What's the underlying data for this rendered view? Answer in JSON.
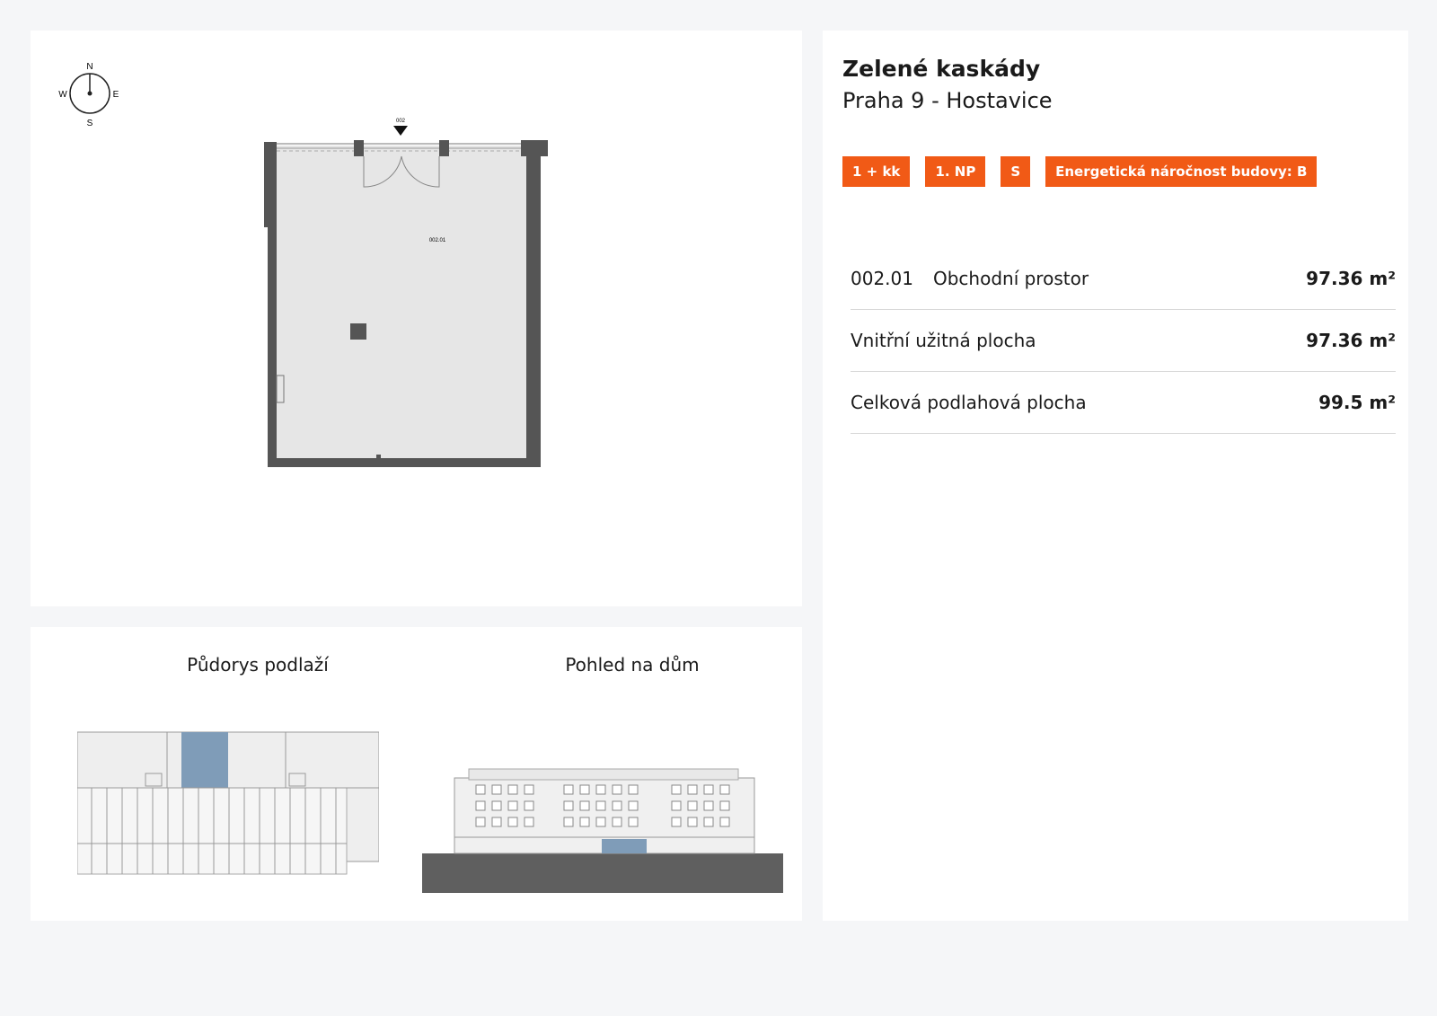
{
  "plan": {
    "compass": {
      "n": "N",
      "s": "S",
      "e": "E",
      "w": "W"
    },
    "entrance_label": "002",
    "room_label": "002.01"
  },
  "views": {
    "floor_plan_title": "Půdorys podlaží",
    "house_view_title": "Pohled na dům"
  },
  "info": {
    "project_name": "Zelené kaskády",
    "location": "Praha 9 - Hostavice",
    "badges": [
      "1 + kk",
      "1. NP",
      "S",
      "Energetická náročnost budovy: B"
    ],
    "rows": [
      {
        "code": "002.01",
        "label": "Obchodní prostor",
        "value": "97.36 m²"
      },
      {
        "code": "",
        "label": "Vnitřní užitná plocha",
        "value": "97.36 m²"
      },
      {
        "code": "",
        "label": "Celková podlahová plocha",
        "value": "99.5 m²"
      }
    ]
  },
  "colors": {
    "accent": "#f15a16",
    "highlight_unit": "#7f9cb8",
    "wall": "#555555",
    "room_fill": "#e6e6e6"
  }
}
